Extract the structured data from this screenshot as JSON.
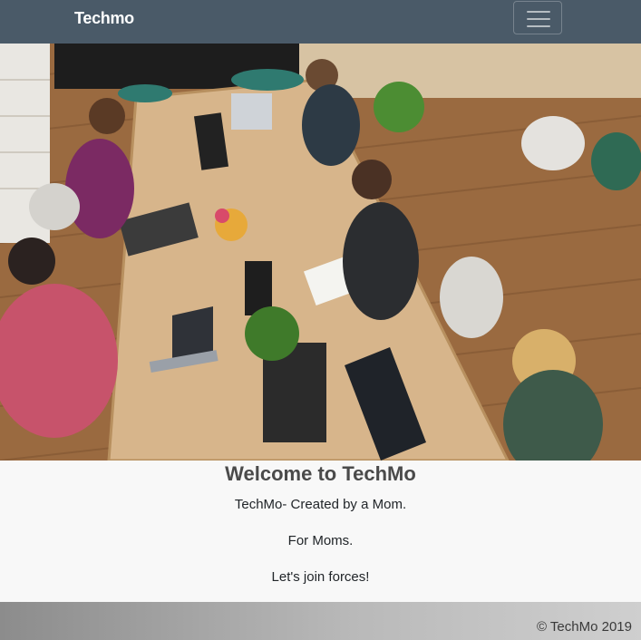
{
  "navbar": {
    "brand": "Techmo",
    "toggler_icon": "hamburger-menu-icon"
  },
  "hero": {
    "image_subject": "women working with laptops around a wooden table"
  },
  "welcome": {
    "title": "Welcome to TechMo",
    "line1": "TechMo- Created by a Mom.",
    "line2": "For Moms.",
    "line3": "Let's join forces!"
  },
  "footer": {
    "copyright": "© TechMo 2019"
  },
  "colors": {
    "navbar_bg": "#4a5a68",
    "page_bg": "#f8f8f8",
    "footer_bg": "#b9b9b9"
  }
}
